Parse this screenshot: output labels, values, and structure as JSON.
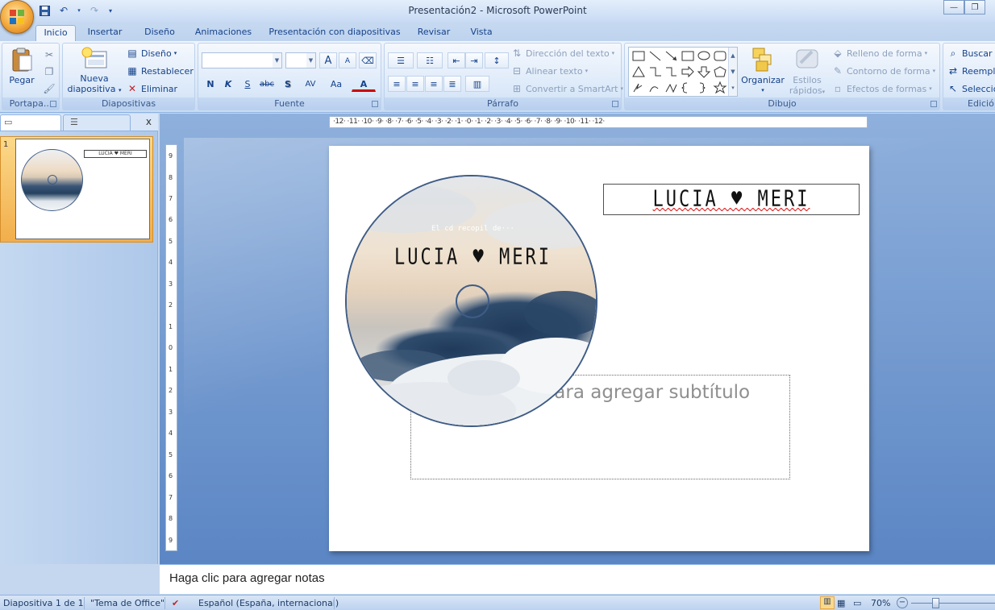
{
  "window": {
    "title": "Presentación2 - Microsoft PowerPoint",
    "minimize": "—",
    "restore": "❐"
  },
  "qat": {
    "save_icon": "save-icon",
    "undo_icon": "undo-icon",
    "redo_icon": "redo-icon",
    "customize_icon": "customize-icon"
  },
  "tabs": [
    {
      "label": "Inicio",
      "active": true
    },
    {
      "label": "Insertar"
    },
    {
      "label": "Diseño"
    },
    {
      "label": "Animaciones"
    },
    {
      "label": "Presentación con diapositivas"
    },
    {
      "label": "Revisar"
    },
    {
      "label": "Vista"
    }
  ],
  "ribbon": {
    "clipboard": {
      "label": "Portapa...",
      "paste": "Pegar"
    },
    "slides": {
      "label": "Diapositivas",
      "new_slide_1": "Nueva",
      "new_slide_2": "diapositiva",
      "layout": "Diseño",
      "reset": "Restablecer",
      "delete": "Eliminar"
    },
    "font": {
      "label": "Fuente",
      "bold": "N",
      "italic": "K",
      "underline": "S",
      "strike": "abc",
      "shadow": "S",
      "spacing": "AV",
      "case": "Aa",
      "grow": "A",
      "shrink": "A",
      "color": "A"
    },
    "paragraph": {
      "label": "Párrafo",
      "text_direction": "Dirección del texto",
      "align_text": "Alinear texto",
      "convert_smartart": "Convertir a SmartArt"
    },
    "drawing": {
      "label": "Dibujo",
      "arrange": "Organizar",
      "quick_styles_1": "Estilos",
      "quick_styles_2": "rápidos",
      "shape_fill": "Relleno de forma",
      "shape_outline": "Contorno de forma",
      "shape_effects": "Efectos de formas"
    },
    "editing": {
      "label": "Edició",
      "find": "Buscar",
      "replace": "Reempl",
      "select": "Selecció"
    }
  },
  "pane": {
    "close": "x",
    "slide_number": "1"
  },
  "ruler": {
    "h_ticks": "·12·  ·11·  ·10·  ·9·  ·8·  ·7·  ·6·  ·5·  ·4·  ·3·  ·2·  ·1·  ·0·  ·1·  ·2·  ·3·  ·4·  ·5·  ·6·  ·7·  ·8·  ·9·  ·10·  ·11·  ·12·"
  },
  "slide": {
    "title_text": "LUCIA ♥ MERI",
    "cd_small_text": "El cd recopil de···",
    "cd_title_text": "LUCIA ♥ MERI",
    "subtitle_placeholder": "Haga clic para agregar subtítulo"
  },
  "notes": {
    "placeholder": "Haga clic para agregar notas"
  },
  "status": {
    "slide_info": "Diapositiva 1 de 1",
    "theme": "\"Tema de Office\"",
    "language": "Español (España, internacional)",
    "zoom": "70%"
  },
  "colors": {
    "ribbon_bg": "#d7e6f8",
    "accent_blue": "#15428b",
    "workspace": "#6f96cf",
    "selected_thumb": "#f2ae4b"
  }
}
